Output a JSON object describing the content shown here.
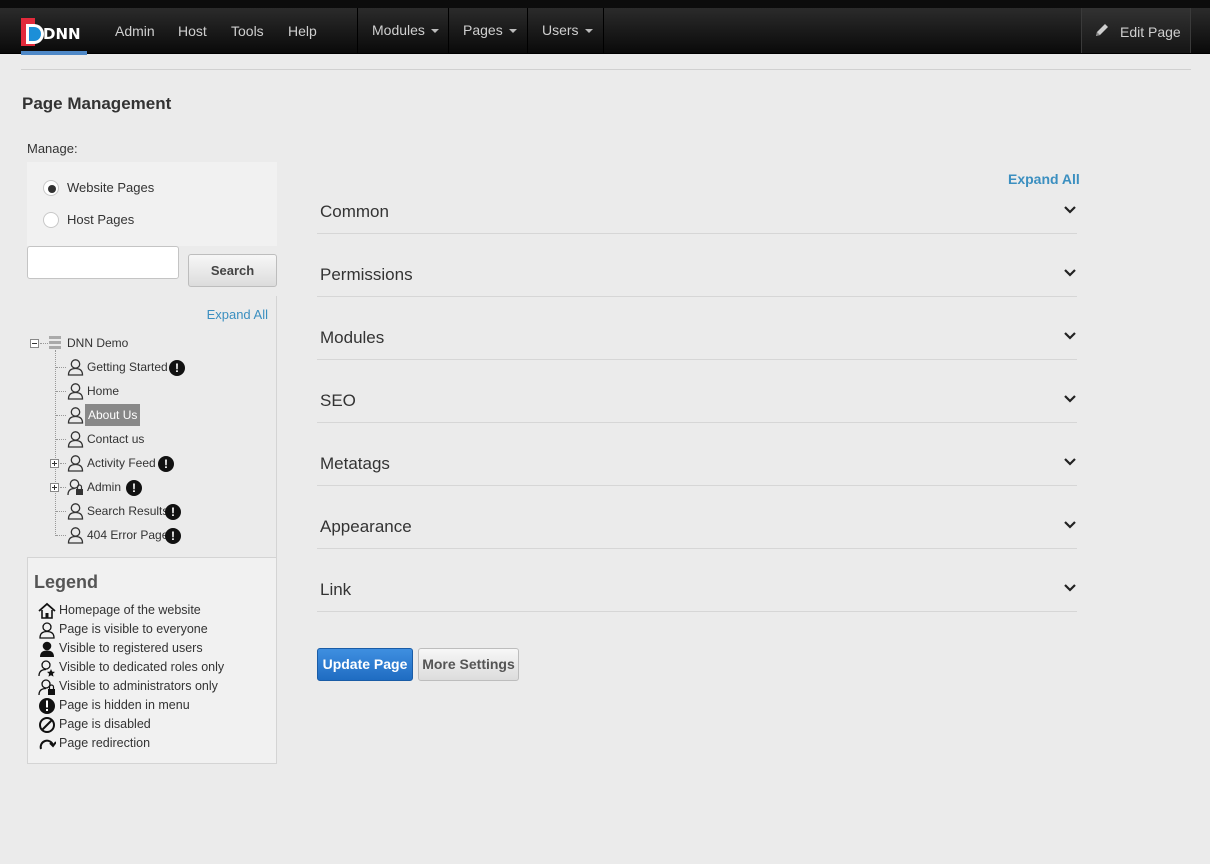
{
  "navbar": {
    "logo_text": "DNN",
    "links": [
      "Admin",
      "Host",
      "Tools",
      "Help"
    ],
    "dropdowns": [
      "Modules",
      "Pages",
      "Users"
    ],
    "edit_page": "Edit Page"
  },
  "page": {
    "title": "Page Management"
  },
  "manage": {
    "label": "Manage:",
    "options": [
      "Website Pages",
      "Host Pages"
    ],
    "selected": "Website Pages"
  },
  "search": {
    "value": "",
    "button": "Search"
  },
  "tree": {
    "expand_all": "Expand All",
    "root": "DNN Demo",
    "items": [
      {
        "label": "Getting Started",
        "hidden": true,
        "expandable": false,
        "admin": false
      },
      {
        "label": "Home",
        "hidden": false,
        "expandable": false,
        "admin": false
      },
      {
        "label": "About Us",
        "hidden": false,
        "expandable": false,
        "admin": false,
        "selected": true
      },
      {
        "label": "Contact us",
        "hidden": false,
        "expandable": false,
        "admin": false
      },
      {
        "label": "Activity Feed",
        "hidden": true,
        "expandable": true,
        "admin": false
      },
      {
        "label": "Admin",
        "hidden": true,
        "expandable": true,
        "admin": true
      },
      {
        "label": "Search Results",
        "hidden": true,
        "expandable": false,
        "admin": false
      },
      {
        "label": "404 Error Page",
        "hidden": true,
        "expandable": false,
        "admin": false
      }
    ]
  },
  "legend": {
    "title": "Legend",
    "items": [
      {
        "icon": "home-icon",
        "label": "Homepage of the website"
      },
      {
        "icon": "user-outline-icon",
        "label": "Page is visible to everyone"
      },
      {
        "icon": "user-filled-icon",
        "label": "Visible to registered users"
      },
      {
        "icon": "user-star-icon",
        "label": "Visible to dedicated roles only"
      },
      {
        "icon": "user-lock-icon",
        "label": "Visible to administrators only"
      },
      {
        "icon": "exclamation-icon",
        "label": "Page is hidden in menu"
      },
      {
        "icon": "disabled-icon",
        "label": "Page is disabled"
      },
      {
        "icon": "redirect-icon",
        "label": "Page redirection"
      }
    ]
  },
  "settings": {
    "expand_all": "Expand All",
    "sections": [
      "Common",
      "Permissions",
      "Modules",
      "SEO",
      "Metatags",
      "Appearance",
      "Link"
    ]
  },
  "actions": {
    "update": "Update Page",
    "more": "More Settings"
  },
  "colors": {
    "accent": "#3b8fc0",
    "primary_button": "#2a7ad3",
    "nav_bg": "#1a1a1a"
  }
}
